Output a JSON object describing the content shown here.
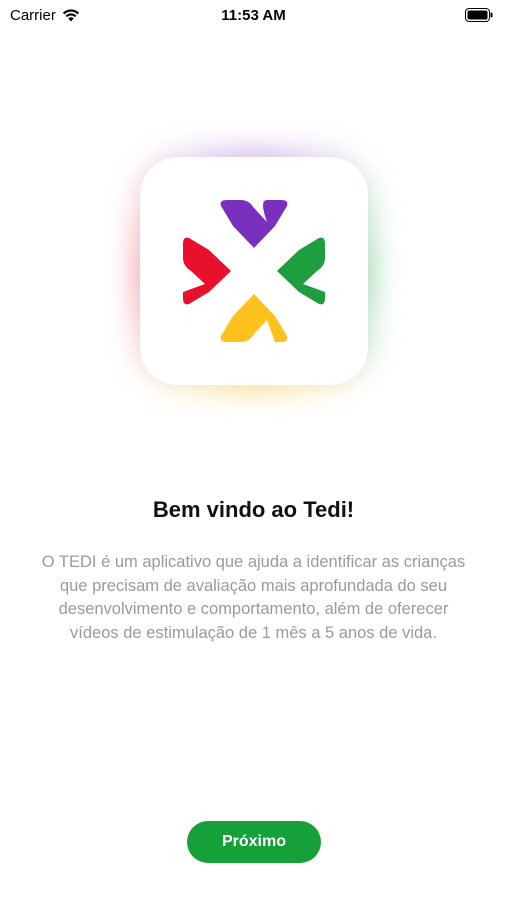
{
  "status_bar": {
    "carrier": "Carrier",
    "time": "11:53 AM",
    "wifi_icon": "wifi-icon",
    "battery_icon": "battery-full-icon"
  },
  "logo": {
    "icon": "tedi-logo-icon",
    "colors": {
      "top": "#7B2FBF",
      "left": "#E8102A",
      "right": "#1E9E3E",
      "bottom": "#FFC11E"
    }
  },
  "welcome": {
    "title": "Bem vindo ao Tedi!",
    "description": "O TEDI é um aplicativo que ajuda a identificar as crianças que precisam de avaliação mais aprofundada do seu desenvolvimento e comportamento, além de oferecer vídeos de estimulação de 1 mês a 5 anos de vida."
  },
  "actions": {
    "next_label": "Próximo",
    "button_color": "#16A03A"
  }
}
